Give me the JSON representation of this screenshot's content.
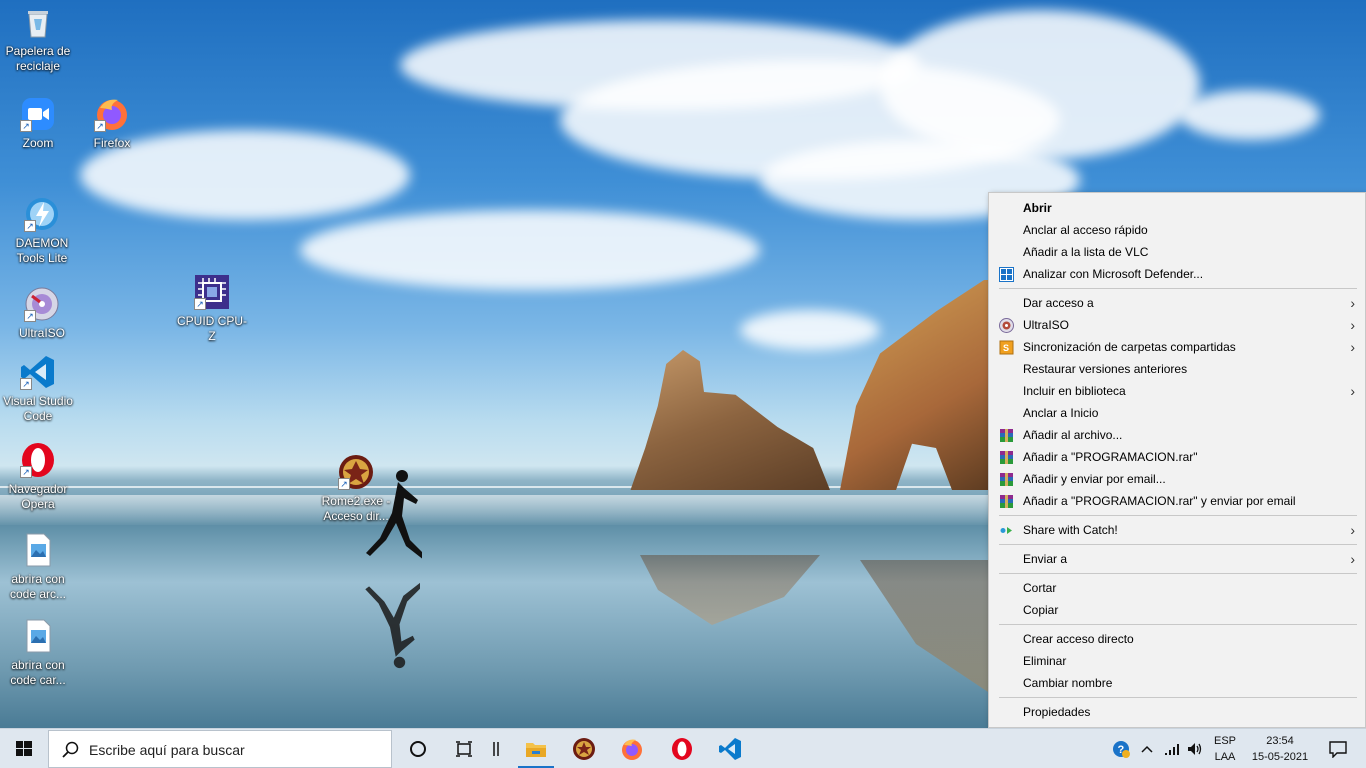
{
  "desktop": {
    "icons": [
      {
        "label": "Papelera de reciclaje"
      },
      {
        "label": "Zoom"
      },
      {
        "label": "Firefox"
      },
      {
        "label": "DAEMON Tools Lite"
      },
      {
        "label": "UltraISO"
      },
      {
        "label": "CPUID CPU-Z"
      },
      {
        "label": "Visual Studio Code"
      },
      {
        "label": "Navegador Opera"
      },
      {
        "label": "Rome2.exe - Acceso dir..."
      },
      {
        "label": "abrira con code arc..."
      },
      {
        "label": "abrira con code car..."
      }
    ]
  },
  "context_menu": {
    "items": [
      {
        "label": "Abrir"
      },
      {
        "label": "Anclar al acceso rápido"
      },
      {
        "label": "Añadir a la lista de VLC"
      },
      {
        "label": "Analizar con Microsoft Defender..."
      },
      {
        "label": "Dar acceso a"
      },
      {
        "label": "UltraISO"
      },
      {
        "label": "Sincronización de carpetas compartidas"
      },
      {
        "label": "Restaurar versiones anteriores"
      },
      {
        "label": "Incluir en biblioteca"
      },
      {
        "label": "Anclar a Inicio"
      },
      {
        "label": "Añadir al archivo..."
      },
      {
        "label": "Añadir a \"PROGRAMACION.rar\""
      },
      {
        "label": "Añadir y enviar por email..."
      },
      {
        "label": "Añadir a \"PROGRAMACION.rar\" y enviar por email"
      },
      {
        "label": "Share with Catch!"
      },
      {
        "label": "Enviar a"
      },
      {
        "label": "Cortar"
      },
      {
        "label": "Copiar"
      },
      {
        "label": "Crear acceso directo"
      },
      {
        "label": "Eliminar"
      },
      {
        "label": "Cambiar nombre"
      },
      {
        "label": "Propiedades"
      }
    ]
  },
  "taskbar": {
    "search_placeholder": "Escribe aquí para buscar",
    "language_top": "ESP",
    "language_bottom": "LAA",
    "time": "23:54",
    "date": "15-05-2021"
  },
  "colors": {
    "accent": "#1a73c8",
    "menu_bg": "#f2f2f2",
    "taskbar_bg": "#dfe7ef"
  }
}
